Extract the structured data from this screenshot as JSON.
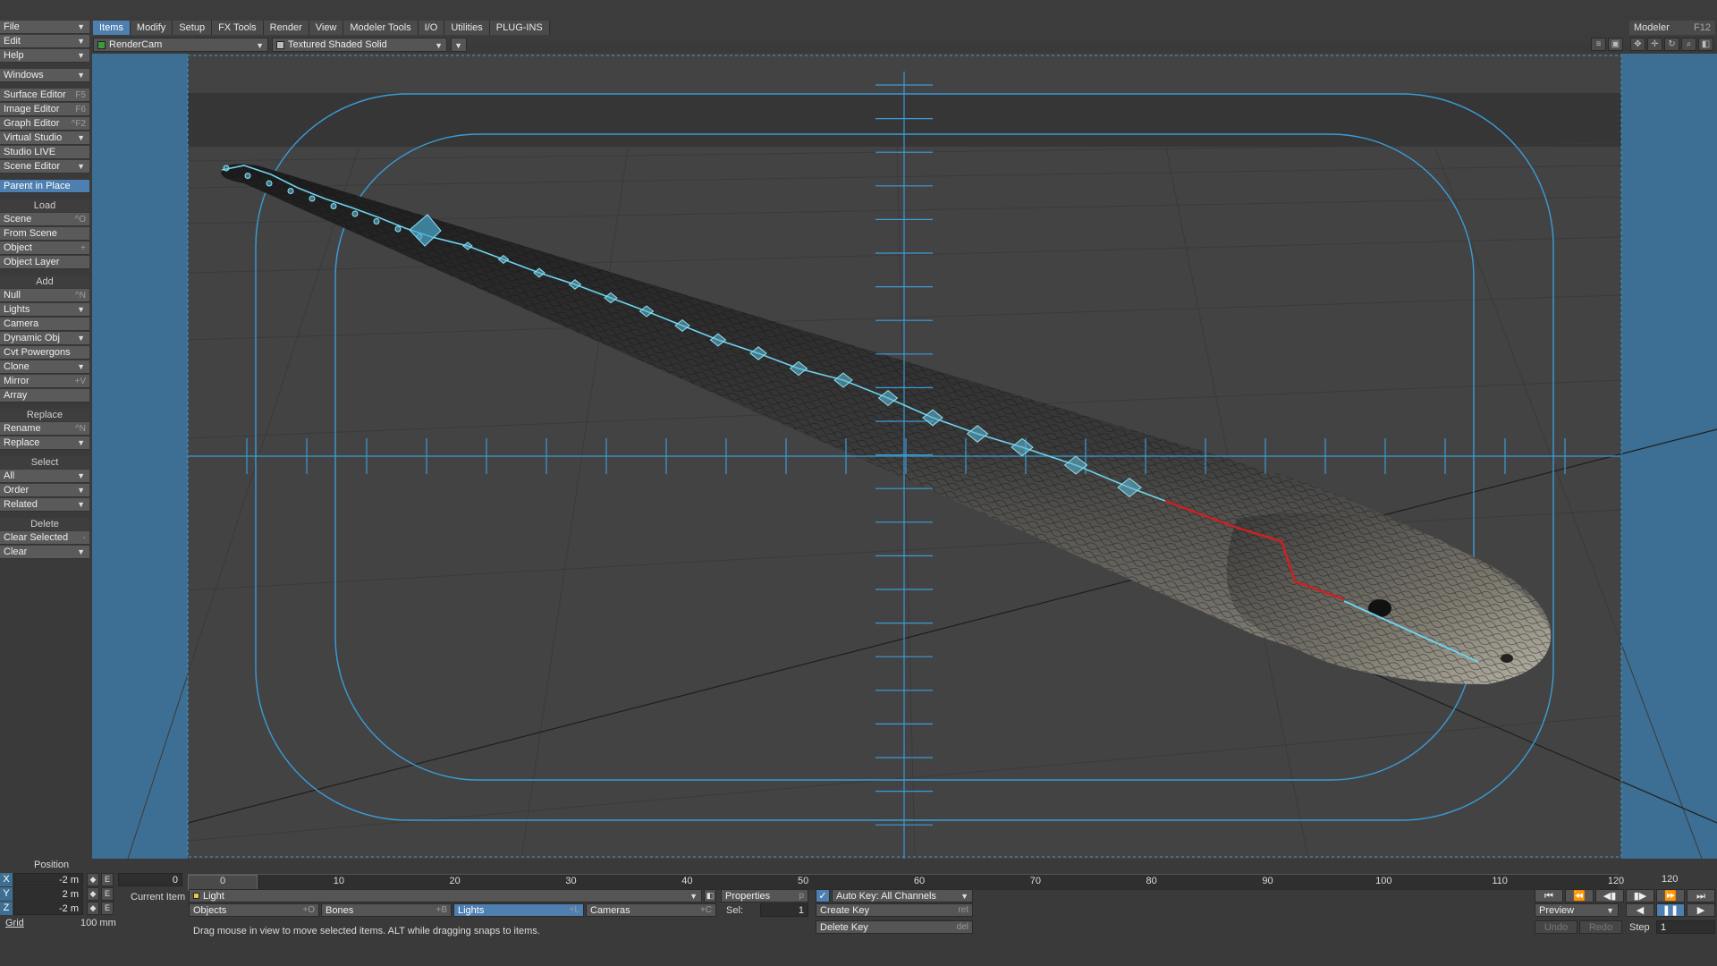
{
  "menu_tabs": [
    "Items",
    "Modify",
    "Setup",
    "FX Tools",
    "Render",
    "View",
    "Modeler Tools",
    "I/O",
    "Utilities",
    "PLUG-INS"
  ],
  "active_tab": "Items",
  "modeler": {
    "label": "Modeler",
    "shortcut": "F12"
  },
  "viewport_header": {
    "camera": "RenderCam",
    "shading": "Textured Shaded Solid"
  },
  "toolbar": {
    "file": "File",
    "edit": "Edit",
    "help": "Help",
    "windows": "Windows",
    "surface_editor": "Surface Editor",
    "surface_editor_sc": "F5",
    "image_editor": "Image Editor",
    "image_editor_sc": "F6",
    "graph_editor": "Graph Editor",
    "graph_editor_sc": "^F2",
    "virtual_studio": "Virtual Studio",
    "studio_live": "Studio LIVE",
    "scene_editor": "Scene Editor",
    "parent_in_place": "Parent in Place",
    "load_head": "Load",
    "scene": "Scene",
    "scene_sc": "^O",
    "from_scene": "From Scene",
    "object": "Object",
    "object_sc": "+",
    "object_layer": "Object Layer",
    "add_head": "Add",
    "null": "Null",
    "null_sc": "^N",
    "lights": "Lights",
    "camera": "Camera",
    "dynamic_obj": "Dynamic Obj",
    "cvt_powergons": "Cvt Powergons",
    "clone": "Clone",
    "mirror": "Mirror",
    "mirror_sc": "+V",
    "array": "Array",
    "replace_head": "Replace",
    "rename": "Rename",
    "rename_sc": "^N",
    "replace": "Replace",
    "select_head": "Select",
    "all": "All",
    "order": "Order",
    "related": "Related",
    "delete_head": "Delete",
    "clear_selected": "Clear Selected",
    "clear_selected_sc": "-",
    "clear": "Clear"
  },
  "ruler": {
    "h_ticks": 23,
    "v_ticks": 23
  },
  "position": {
    "title": "Position",
    "x": "-2 m",
    "y": "2 m",
    "z": "-2 m",
    "x_label": "X",
    "y_label": "Y",
    "z_label": "Z",
    "e_label": "E",
    "grid_label": "Grid",
    "grid": "100 mm"
  },
  "timeline": {
    "start_field": "0",
    "current_frame": "0",
    "ticks": [
      "0",
      "10",
      "20",
      "30",
      "40",
      "50",
      "60",
      "70",
      "80",
      "90",
      "100",
      "110",
      "120"
    ],
    "end_field": "120"
  },
  "current_item": {
    "label": "Current Item",
    "value": "Light"
  },
  "item_types": [
    {
      "label": "Objects",
      "sc": "+O"
    },
    {
      "label": "Bones",
      "sc": "+B"
    },
    {
      "label": "Lights",
      "sc": "+L"
    },
    {
      "label": "Cameras",
      "sc": "+C"
    }
  ],
  "properties": {
    "label": "Properties",
    "sc": "p"
  },
  "sel": {
    "label": "Sel:",
    "value": "1"
  },
  "keys": {
    "auto_key": "Auto Key: All Channels",
    "create_key": "Create Key",
    "create_key_sc": "ret",
    "delete_key": "Delete Key",
    "delete_key_sc": "del"
  },
  "status_text": "Drag mouse in view to move selected items. ALT while dragging snaps to items.",
  "playback": {
    "preview": "Preview",
    "undo": "Undo",
    "redo": "Redo",
    "step_label": "Step",
    "step": "1"
  },
  "colors": {
    "accent": "#4d7fb0",
    "guides": "#3a9cd8",
    "bone": "#6fd3ee",
    "bone_red": "#d02020"
  }
}
